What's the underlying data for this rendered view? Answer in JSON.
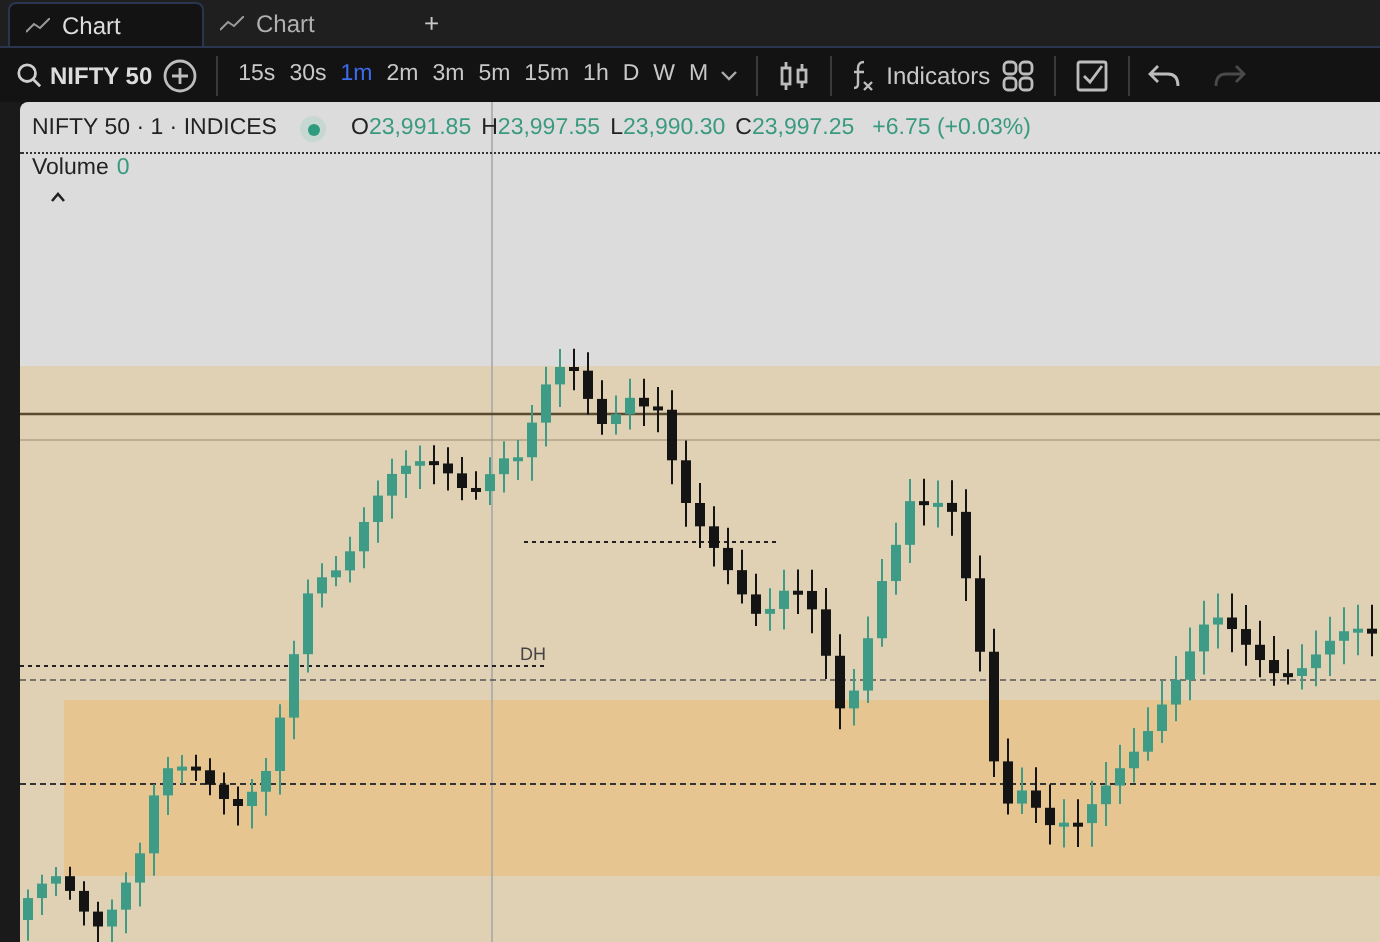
{
  "tabs": [
    {
      "label": "Chart",
      "selected": true
    },
    {
      "label": "Chart",
      "selected": false
    }
  ],
  "new_tab": "+",
  "toolbar": {
    "symbol": "NIFTY 50",
    "intervals": [
      {
        "label": "15s",
        "selected": false
      },
      {
        "label": "30s",
        "selected": false
      },
      {
        "label": "1m",
        "selected": true
      },
      {
        "label": "2m",
        "selected": false
      },
      {
        "label": "3m",
        "selected": false
      },
      {
        "label": "5m",
        "selected": false
      },
      {
        "label": "15m",
        "selected": false
      },
      {
        "label": "1h",
        "selected": false
      },
      {
        "label": "D",
        "selected": false
      },
      {
        "label": "W",
        "selected": false
      },
      {
        "label": "M",
        "selected": false
      }
    ],
    "indicators": "Indicators",
    "undo_disabled": false,
    "redo_disabled": true
  },
  "legend": {
    "title": "NIFTY 50 · 1 · INDICES",
    "ohlc": [
      {
        "label": "O",
        "value": "23,991.85"
      },
      {
        "label": "H",
        "value": "23,997.55"
      },
      {
        "label": "L",
        "value": "23,990.30"
      },
      {
        "label": "C",
        "value": "23,997.25"
      }
    ],
    "change": "+6.75 (+0.03%)"
  },
  "volume": {
    "label": "Volume",
    "value": "0"
  },
  "chart": {
    "level_label": "DH"
  }
}
